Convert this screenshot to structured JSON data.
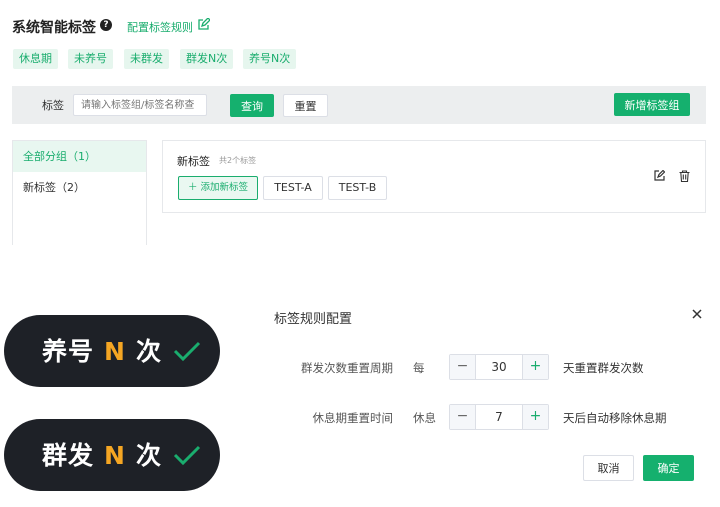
{
  "header": {
    "title": "系统智能标签",
    "help_icon": "?",
    "config_link": "配置标签规则"
  },
  "quick_tags": [
    "休息期",
    "未养号",
    "未群发",
    "群发N次",
    "养号N次"
  ],
  "filter": {
    "label": "标签",
    "placeholder": "请输入标签组/标签名称查",
    "search": "查询",
    "reset": "重置",
    "add_group": "新增标签组"
  },
  "sidebar": {
    "items": [
      {
        "label": "全部分组（1）",
        "active": true
      },
      {
        "label": "新标签（2）",
        "active": false
      }
    ]
  },
  "card": {
    "title": "新标签",
    "count": "共2个标签",
    "add_label": "＋ 添加新标签",
    "tags": [
      "TEST-A",
      "TEST-B"
    ]
  },
  "dialog": {
    "title": "标签规则配置",
    "row1": {
      "label": "群发次数重置周期",
      "pre": "每",
      "value": "30",
      "post": "天重置群发次数"
    },
    "row2": {
      "label": "休息期重置时间",
      "pre": "休息",
      "value": "7",
      "post": "天后自动移除休息期"
    },
    "cancel": "取消",
    "ok": "确定"
  },
  "pills": [
    {
      "pre": "养号",
      "n": "N",
      "post": "次"
    },
    {
      "pre": "群发",
      "n": "N",
      "post": "次"
    }
  ],
  "colors": {
    "accent": "#1aad6e",
    "pill_bg": "#1e2127",
    "pill_accent": "#f5a623"
  }
}
